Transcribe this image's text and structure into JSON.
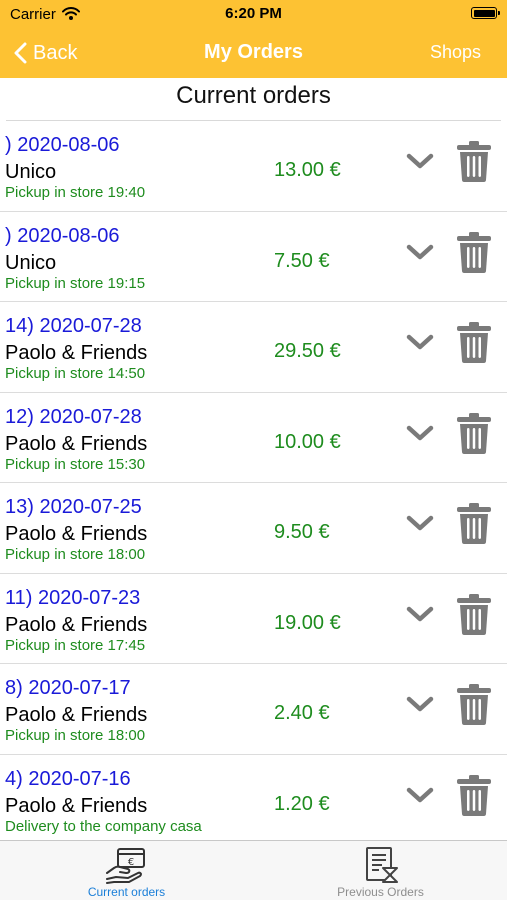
{
  "status_bar": {
    "carrier": "Carrier",
    "time": "6:20 PM"
  },
  "nav": {
    "back_label": "Back",
    "title": "My Orders",
    "shops_label": "Shops"
  },
  "section_title": "Current orders",
  "orders": [
    {
      "head": ") 2020-08-06",
      "shop": "Unico",
      "status": "Pickup in store 19:40",
      "price": "13.00 €"
    },
    {
      "head": ") 2020-08-06",
      "shop": "Unico",
      "status": "Pickup in store 19:15",
      "price": "7.50 €"
    },
    {
      "head": "14) 2020-07-28",
      "shop": "Paolo & Friends",
      "status": "Pickup in store 14:50",
      "price": "29.50 €"
    },
    {
      "head": "12) 2020-07-28",
      "shop": "Paolo & Friends",
      "status": "Pickup in store 15:30",
      "price": "10.00 €"
    },
    {
      "head": "13) 2020-07-25",
      "shop": "Paolo & Friends",
      "status": "Pickup in store 18:00",
      "price": "9.50 €"
    },
    {
      "head": "11) 2020-07-23",
      "shop": "Paolo & Friends",
      "status": "Pickup in store 17:45",
      "price": "19.00 €"
    },
    {
      "head": "8) 2020-07-17",
      "shop": "Paolo & Friends",
      "status": "Pickup in store 18:00",
      "price": "2.40 €"
    },
    {
      "head": "4) 2020-07-16",
      "shop": "Paolo & Friends",
      "status": "Delivery to the company casa",
      "price": "1.20 €"
    }
  ],
  "tabs": [
    {
      "label": "Current orders",
      "icon": "hand-card-icon",
      "active": true
    },
    {
      "label": "Previous Orders",
      "icon": "receipt-hourglass-icon",
      "active": false
    }
  ],
  "colors": {
    "accent": "#fdc233",
    "order_head": "#1a1ad8",
    "status_green": "#1e8c1e",
    "icon_gray": "#7a7a7a",
    "tab_active": "#1b7fd8",
    "tab_inactive": "#8e8e8e"
  }
}
